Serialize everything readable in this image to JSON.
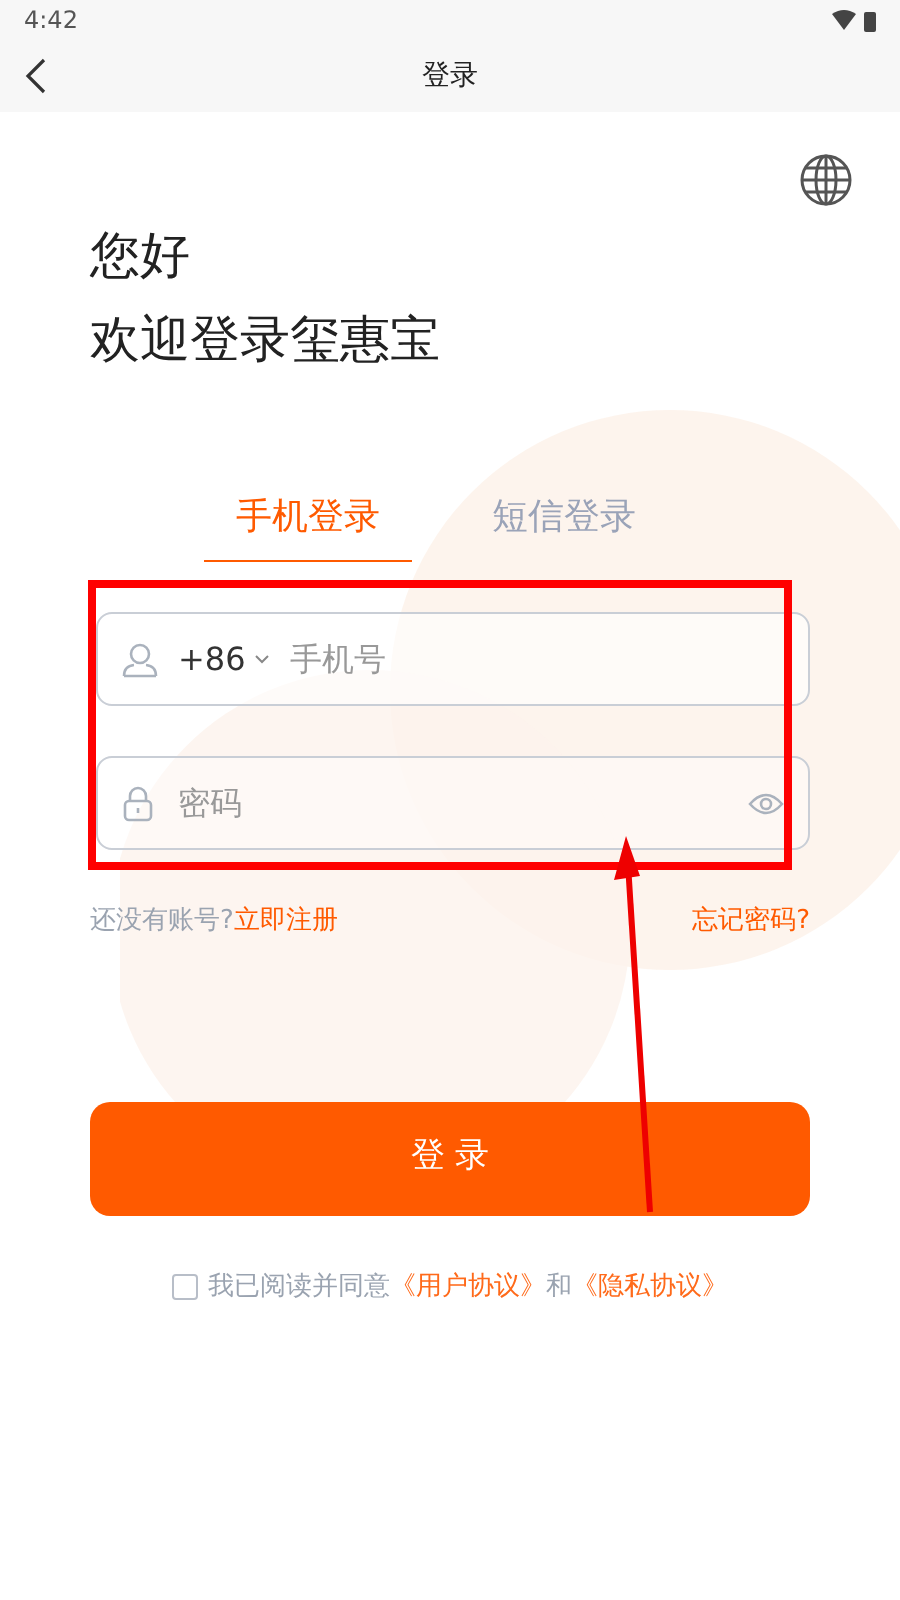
{
  "status_bar": {
    "time": "4:42"
  },
  "nav": {
    "title": "登录"
  },
  "greeting": [
    "您好",
    "欢迎登录玺惠宝"
  ],
  "tabs": [
    {
      "label": "手机登录",
      "selected": true
    },
    {
      "label": "短信登录",
      "selected": false
    }
  ],
  "phone_field": {
    "country_code": "+86",
    "placeholder": "手机号"
  },
  "password_field": {
    "placeholder": "密码"
  },
  "register_prompt": "还没有账号?",
  "register_link": "立即注册",
  "forgot_link": "忘记密码?",
  "login_button": "登 录",
  "agreement": {
    "checked": false,
    "text": "我已阅读并同意",
    "link_1": "《用户协议》",
    "joiner": "和",
    "link_2": "《隐私协议》"
  }
}
